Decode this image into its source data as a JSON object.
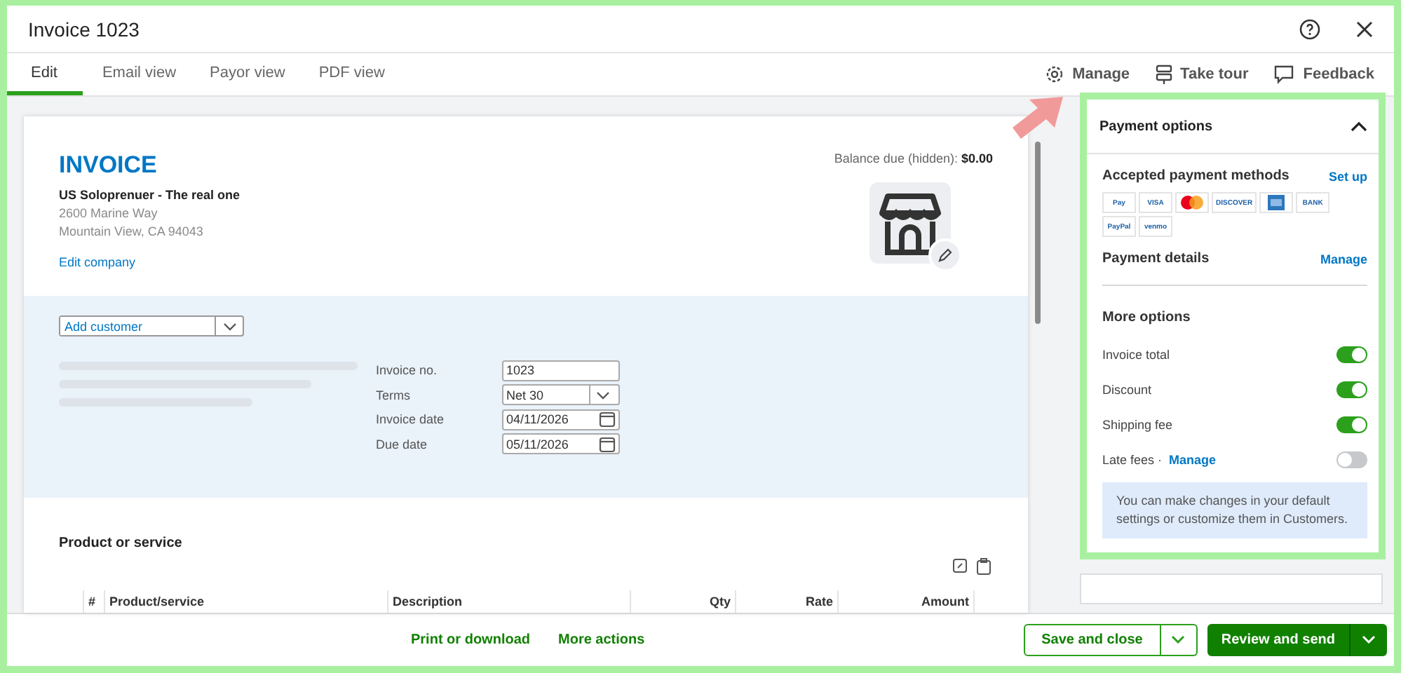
{
  "window": {
    "title": "Invoice 1023"
  },
  "tabs": [
    {
      "label": "Edit",
      "selected": true
    },
    {
      "label": "Email view",
      "selected": false
    },
    {
      "label": "Payor view",
      "selected": false
    },
    {
      "label": "PDF view",
      "selected": false
    }
  ],
  "toolbar": [
    {
      "kind": "gear",
      "label": "Manage"
    },
    {
      "kind": "tour",
      "label": "Take tour"
    },
    {
      "kind": "feedback",
      "label": "Feedback"
    }
  ],
  "invoice": {
    "heading": "INVOICE",
    "company": "US Soloprenuer - The real one",
    "address": [
      "2600 Marine Way",
      "Mountain View, CA 94043"
    ],
    "edit_link": "Edit company",
    "balance_label": "Balance due (hidden):",
    "balance_value": "$0.00",
    "customer": {
      "placeholder": "Add customer"
    },
    "fields": [
      {
        "kind": "text",
        "label": "Invoice no.",
        "value": "1023"
      },
      {
        "kind": "select",
        "label": "Terms",
        "value": "Net 30"
      },
      {
        "kind": "date",
        "label": "Invoice date",
        "value": "04/11/2026"
      },
      {
        "kind": "date",
        "label": "Due date",
        "value": "05/11/2026"
      }
    ],
    "section_title": "Product or service",
    "columns": [
      "#",
      "Product/service",
      "Description",
      "Qty",
      "Rate",
      "Amount"
    ]
  },
  "payment_panel": {
    "title": "Payment options",
    "expanded": true,
    "methods_title": "Accepted payment methods",
    "methods_link": "Set up",
    "methods": [
      {
        "kind": "text",
        "label": "Pay"
      },
      {
        "kind": "text",
        "label": "VISA"
      },
      {
        "kind": "mastercard"
      },
      {
        "kind": "text",
        "label": "DISCOVER"
      },
      {
        "kind": "amex"
      },
      {
        "kind": "text",
        "label": "BANK"
      },
      {
        "kind": "text",
        "label": "PayPal"
      },
      {
        "kind": "text",
        "label": "venmo"
      }
    ],
    "details_title": "Payment details",
    "details_link": "Manage",
    "more_title": "More options",
    "options": [
      {
        "label": "Invoice total",
        "on": true
      },
      {
        "label": "Discount",
        "on": true
      },
      {
        "label": "Shipping fee",
        "on": true
      },
      {
        "label": "Late fees ·",
        "link": "Manage",
        "on": false
      }
    ],
    "note": "You can make changes in your default settings or customize them in Customers."
  },
  "footer": {
    "links": [
      "Print or download",
      "More actions"
    ],
    "save": "Save and close",
    "send": "Review and send"
  }
}
